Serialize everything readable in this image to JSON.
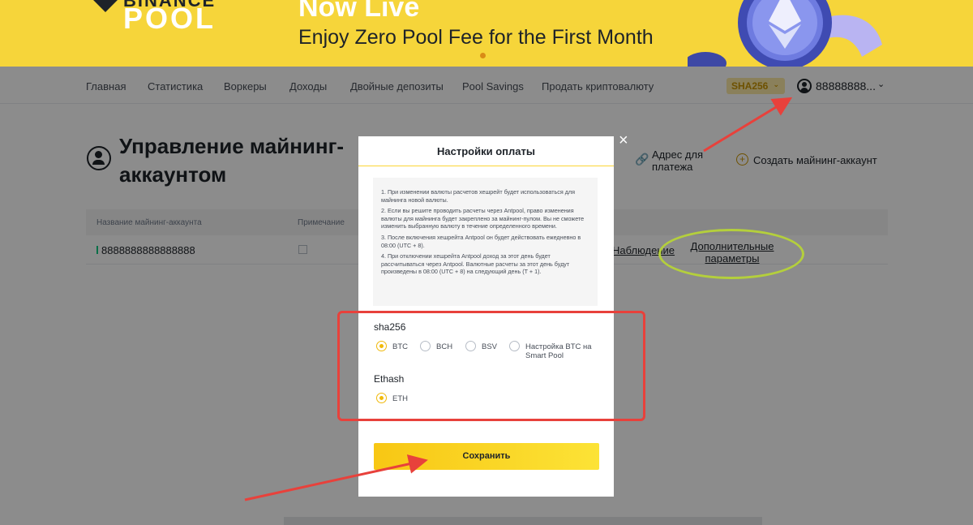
{
  "banner": {
    "brand_top": "BINANCE",
    "brand_bottom": "POOL",
    "headline": "Now Live",
    "subheadline": "Enjoy Zero Pool Fee for the First Month"
  },
  "nav": {
    "items": [
      "Главная",
      "Статистика",
      "Воркеры",
      "Доходы",
      "Двойные депозиты",
      "Pool Savings",
      "Продать криптовалюту"
    ],
    "algo": "SHA256",
    "algo_chevron": "⌄",
    "user": "88888888...",
    "user_chevron": "⌄"
  },
  "page": {
    "title": "Управление майнинг-аккаунтом",
    "payment_address": "Адрес для платежа",
    "create_account": "Создать майнинг-аккаунт",
    "columns": [
      "Название майнинг-аккаунта",
      "Примечание"
    ],
    "row": {
      "name": "8888888888888888",
      "watch": "Наблюдение",
      "more": "Дополнительные параметры"
    }
  },
  "modal": {
    "title": "Настройки оплаты",
    "close_glyph": "×",
    "notes": [
      "1. При изменении валюты расчетов хешрейт будет использоваться для майнинга новой валюты.",
      "2. Если вы решите проводить расчеты через Antpool, право изменения валюты для майнинга будет закреплено за майнинг-пулом. Вы не сможете изменить выбранную валюту в течение определенного времени.",
      "3. После включения хешрейта Antpool он будет действовать ежедневно в 08:00 (UTC + 8).",
      "4. При отключении хешрейта Antpool доход за этот день будет рассчитываться через Antpool. Валютные расчеты за этот день будут произведены в 08:00 (UTC + 8) на следующий день (T + 1)."
    ],
    "groups": [
      {
        "title": "sha256",
        "options": [
          {
            "label": "BTC",
            "checked": true
          },
          {
            "label": "BCH",
            "checked": false
          },
          {
            "label": "BSV",
            "checked": false
          },
          {
            "label": "Настройка BTC на Smart Pool",
            "checked": false
          }
        ]
      },
      {
        "title": "Ethash",
        "options": [
          {
            "label": "ETH",
            "checked": true
          }
        ]
      }
    ],
    "save_label": "Сохранить"
  },
  "colors": {
    "banner_yellow": "#f6d53a",
    "accent": "#f0b90b",
    "annotation_red": "#e8413b",
    "annotation_green": "#b4cf3c"
  }
}
